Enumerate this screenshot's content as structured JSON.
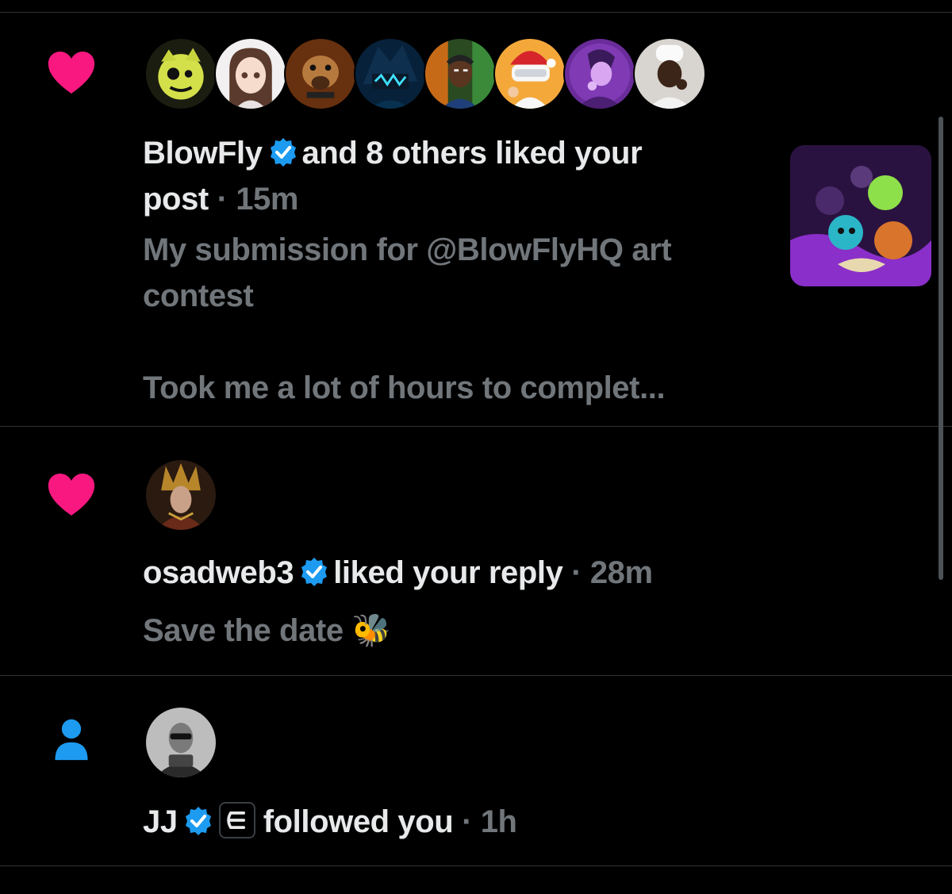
{
  "notifications": [
    {
      "type": "like",
      "icon": "heart-icon",
      "actor": "BlowFly",
      "verified": true,
      "action_line1": "and 8 others liked your",
      "action_line2": "post",
      "time": "15m",
      "separator": "·",
      "post_text_line1": "My submission for @BlowFlyHQ art",
      "post_text_line2": "contest",
      "post_text_line3": "Took me a lot of hours to complet...",
      "avatar_count": 8
    },
    {
      "type": "like",
      "icon": "heart-icon",
      "actor": "osadweb3",
      "verified": true,
      "action": "liked your reply",
      "time": "28m",
      "separator": "·",
      "post_text": "Save the date",
      "emoji": "🐝"
    },
    {
      "type": "follow",
      "icon": "person-icon",
      "actor": "JJ",
      "verified": true,
      "affiliate_badge": "affiliate-badge-icon",
      "action": "followed you",
      "time": "1h",
      "separator": "·"
    }
  ],
  "colors": {
    "background": "#000000",
    "divider": "#2f3336",
    "primary_text": "#e7e9ea",
    "secondary_text": "#71767b",
    "like_pink": "#f91880",
    "follow_blue": "#1d9bf0",
    "verified_blue": "#1d9bf0"
  }
}
